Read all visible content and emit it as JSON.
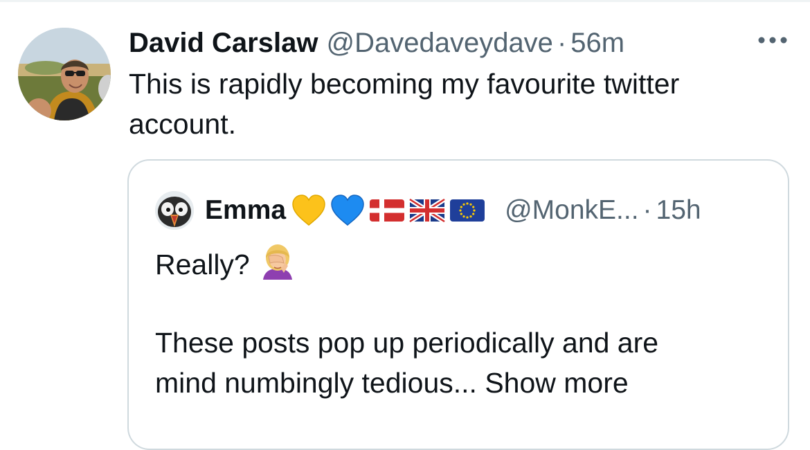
{
  "tweet": {
    "author_name": "David Carslaw",
    "author_handle": "@Davedaveydave",
    "separator": "·",
    "time": "56m",
    "text_line1": "This is rapidly becoming my favourite twitter",
    "text_line2": "account.",
    "more_icon": "more-horizontal-icon"
  },
  "quote": {
    "author_name": "Emma",
    "emojis": [
      "yellow-heart-icon",
      "blue-heart-icon",
      "denmark-flag-icon",
      "uk-flag-icon",
      "eu-flag-icon"
    ],
    "author_handle": "@MonkE...",
    "separator": "·",
    "time": "15h",
    "line1": "Really?",
    "line1_emoji": "woman-facepalming-icon",
    "line3": "These posts pop up periodically and are",
    "line4_text": "mind numbingly tedious...",
    "show_more": "Show more"
  },
  "colors": {
    "text_primary": "#0f1419",
    "text_secondary": "#536471",
    "border": "#cfd9de"
  }
}
